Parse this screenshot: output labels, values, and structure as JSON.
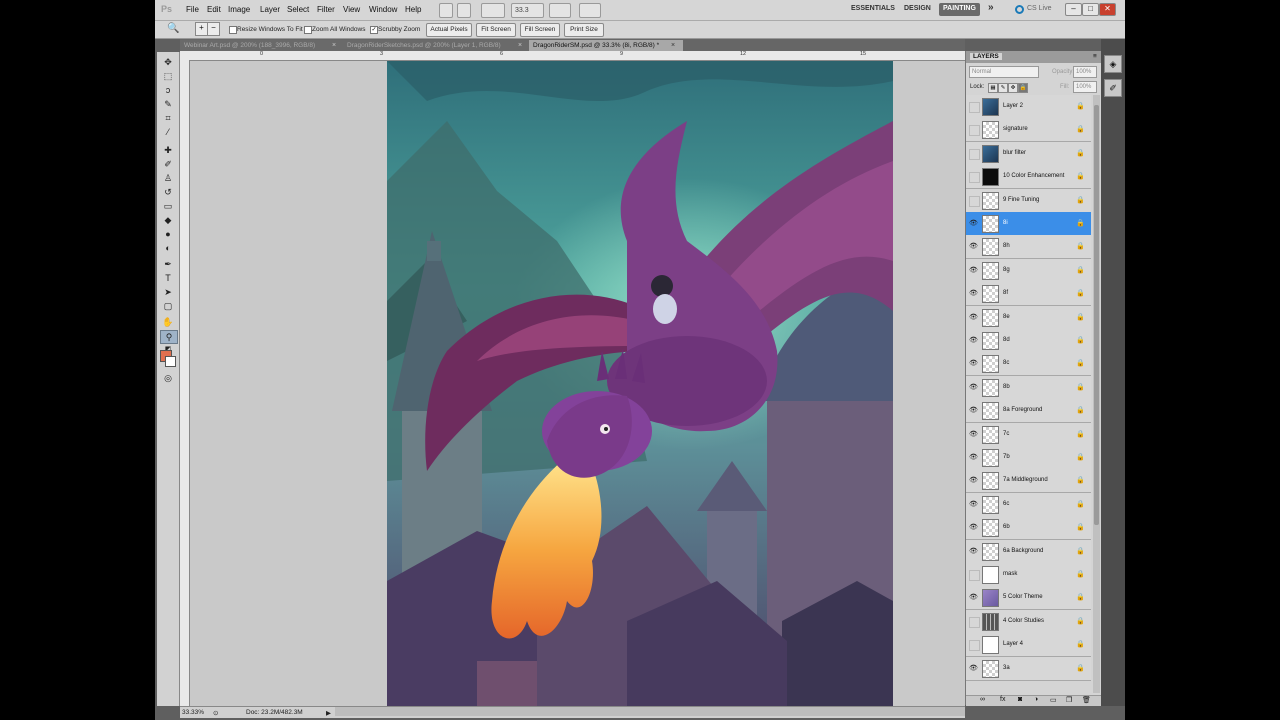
{
  "app": {
    "logo": "Ps"
  },
  "menu": [
    "File",
    "Edit",
    "Image",
    "Layer",
    "Select",
    "Filter",
    "View",
    "Window",
    "Help"
  ],
  "zoom_field": "33.3",
  "workspaces": [
    "ESSENTIALS",
    "DESIGN",
    "PAINTING"
  ],
  "active_workspace": "PAINTING",
  "more_label": "»",
  "cs_live": "CS Live",
  "options": {
    "resize_windows": "Resize Windows To Fit",
    "zoom_all": "Zoom All Windows",
    "scrubby_zoom": "Scrubby Zoom",
    "scrubby_checked": true,
    "actual_pixels": "Actual Pixels",
    "fit_screen": "Fit Screen",
    "fill_screen": "Fill Screen",
    "print_size": "Print Size"
  },
  "tabs": [
    {
      "label": "Webinar Art.psd @ 200% (188_3996, RGB/8)",
      "active": false
    },
    {
      "label": "DragonRiderSketches.psd @ 200% (Layer 1, RGB/8)",
      "active": false
    },
    {
      "label": "DragonRiderSM.psd @ 33.3% (8i, RGB/8) *",
      "active": true
    }
  ],
  "status": {
    "zoom": "33.33%",
    "doc": "Doc: 23.2M/482.3M"
  },
  "layers_panel": {
    "title": "LAYERS",
    "blend_mode": "Normal",
    "opacity_label": "Opacity:",
    "opacity": "100%",
    "lock_label": "Lock:",
    "fill_label": "Fill:",
    "fill": "100%",
    "items": [
      {
        "name": "Layer 2",
        "visible": false,
        "thumb": "blue"
      },
      {
        "name": "signature",
        "visible": false,
        "thumb": "transparent"
      },
      {
        "name": "blur filter",
        "visible": false,
        "thumb": "blue"
      },
      {
        "name": "10 Color Enhancement",
        "visible": false,
        "thumb": "black"
      },
      {
        "name": "9 Fine Tuning",
        "visible": false,
        "thumb": "transparent"
      },
      {
        "name": "8i",
        "visible": true,
        "thumb": "transparent",
        "selected": true
      },
      {
        "name": "8h",
        "visible": true,
        "thumb": "transparent"
      },
      {
        "name": "8g",
        "visible": true,
        "thumb": "transparent"
      },
      {
        "name": "8f",
        "visible": true,
        "thumb": "transparent"
      },
      {
        "name": "8e",
        "visible": true,
        "thumb": "transparent"
      },
      {
        "name": "8d",
        "visible": true,
        "thumb": "transparent"
      },
      {
        "name": "8c",
        "visible": true,
        "thumb": "transparent"
      },
      {
        "name": "8b",
        "visible": true,
        "thumb": "transparent"
      },
      {
        "name": "8a Foreground",
        "visible": true,
        "thumb": "transparent"
      },
      {
        "name": "7c",
        "visible": true,
        "thumb": "transparent"
      },
      {
        "name": "7b",
        "visible": true,
        "thumb": "transparent"
      },
      {
        "name": "7a Middleground",
        "visible": true,
        "thumb": "transparent"
      },
      {
        "name": "6c",
        "visible": true,
        "thumb": "transparent"
      },
      {
        "name": "6b",
        "visible": true,
        "thumb": "transparent"
      },
      {
        "name": "6a Background",
        "visible": true,
        "thumb": "transparent"
      },
      {
        "name": "mask",
        "visible": false,
        "thumb": "mask"
      },
      {
        "name": "5 Color Theme",
        "visible": true,
        "thumb": "purple"
      },
      {
        "name": "4 Color Studies",
        "visible": false,
        "thumb": "grid"
      },
      {
        "name": "Layer 4",
        "visible": false,
        "thumb": "white"
      },
      {
        "name": "3a",
        "visible": true,
        "thumb": "transparent"
      }
    ]
  },
  "colors": {
    "selection": "#3b8ee8",
    "foreground_swatch": "#e07050",
    "background_swatch": "#ffffff",
    "active_workspace_bg": "#6a6a6a"
  }
}
